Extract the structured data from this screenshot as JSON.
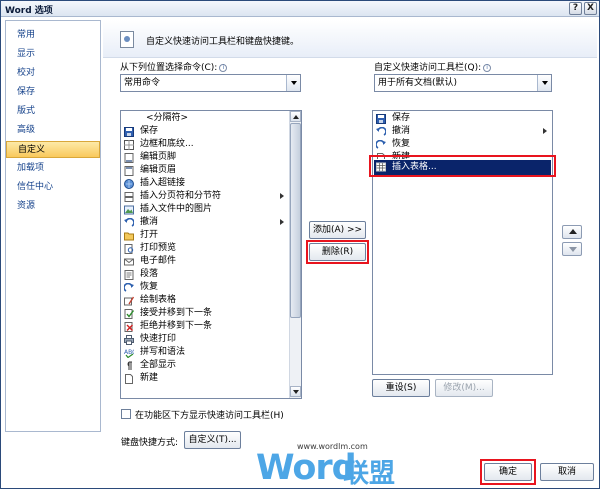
{
  "window": {
    "title": "Word 选项",
    "help_glyph": "?",
    "close_glyph": "X"
  },
  "sidebar": {
    "items": [
      {
        "label": "常用"
      },
      {
        "label": "显示"
      },
      {
        "label": "校对"
      },
      {
        "label": "保存"
      },
      {
        "label": "版式"
      },
      {
        "label": "高级"
      },
      {
        "label": "自定义",
        "active": true
      },
      {
        "label": "加载项"
      },
      {
        "label": "信任中心"
      },
      {
        "label": "资源"
      }
    ]
  },
  "header": {
    "text": "自定义快速访问工具栏和键盘快捷键。"
  },
  "left_panel": {
    "label": "从下列位置选择命令(C):",
    "info_glyph": "i",
    "combo_value": "常用命令",
    "items": [
      {
        "label": "<分隔符>",
        "icon": "separator-icon"
      },
      {
        "label": "保存",
        "icon": "save-icon"
      },
      {
        "label": "边框和底纹...",
        "icon": "borders-icon"
      },
      {
        "label": "编辑页脚",
        "icon": "footer-icon"
      },
      {
        "label": "编辑页眉",
        "icon": "header-icon"
      },
      {
        "label": "插入超链接",
        "icon": "hyperlink-icon"
      },
      {
        "label": "插入分页符和分节符",
        "icon": "page-break-icon",
        "submenu": true
      },
      {
        "label": "插入文件中的图片",
        "icon": "picture-icon"
      },
      {
        "label": "撤消",
        "icon": "undo-icon",
        "submenu": true
      },
      {
        "label": "打开",
        "icon": "open-folder-icon"
      },
      {
        "label": "打印预览",
        "icon": "print-preview-icon"
      },
      {
        "label": "电子邮件",
        "icon": "email-icon"
      },
      {
        "label": "段落",
        "icon": "paragraph-icon"
      },
      {
        "label": "恢复",
        "icon": "redo-icon"
      },
      {
        "label": "绘制表格",
        "icon": "draw-table-icon"
      },
      {
        "label": "接受并移到下一条",
        "icon": "accept-icon"
      },
      {
        "label": "拒绝并移到下一条",
        "icon": "reject-icon"
      },
      {
        "label": "快速打印",
        "icon": "quick-print-icon"
      },
      {
        "label": "拼写和语法",
        "icon": "spelling-icon"
      },
      {
        "label": "全部显示",
        "icon": "show-all-icon"
      },
      {
        "label": "新建",
        "icon": "new-document-icon"
      }
    ]
  },
  "middle_buttons": {
    "add": "添加(A) >>",
    "remove": "删除(R)"
  },
  "right_panel": {
    "label": "自定义快速访问工具栏(Q):",
    "info_glyph": "i",
    "combo_value": "用于所有文档(默认)",
    "items": [
      {
        "label": "保存",
        "icon": "save-icon"
      },
      {
        "label": "撤消",
        "icon": "undo-icon",
        "submenu": true
      },
      {
        "label": "恢复",
        "icon": "redo-icon"
      },
      {
        "label": "新建",
        "icon": "new-document-icon"
      },
      {
        "label": "插入表格...",
        "icon": "table-icon",
        "selected": true
      }
    ],
    "reset_button": "重设(S)",
    "modify_button": "修改(M)..."
  },
  "checkbox": {
    "label": "在功能区下方显示快速访问工具栏(H)",
    "checked": false
  },
  "shortcut": {
    "label": "键盘快捷方式:",
    "button": "自定义(T)..."
  },
  "watermark": {
    "url": "www.wordlm.com",
    "brand_latin": "Word",
    "brand_cn": "联盟"
  },
  "footer": {
    "ok": "确定",
    "cancel": "取消"
  },
  "colors": {
    "highlight_red": "#e8141e",
    "selection_blue": "#0a246a",
    "sidebar_active": "#f9c95c",
    "watermark_blue": "#4da6e6"
  }
}
